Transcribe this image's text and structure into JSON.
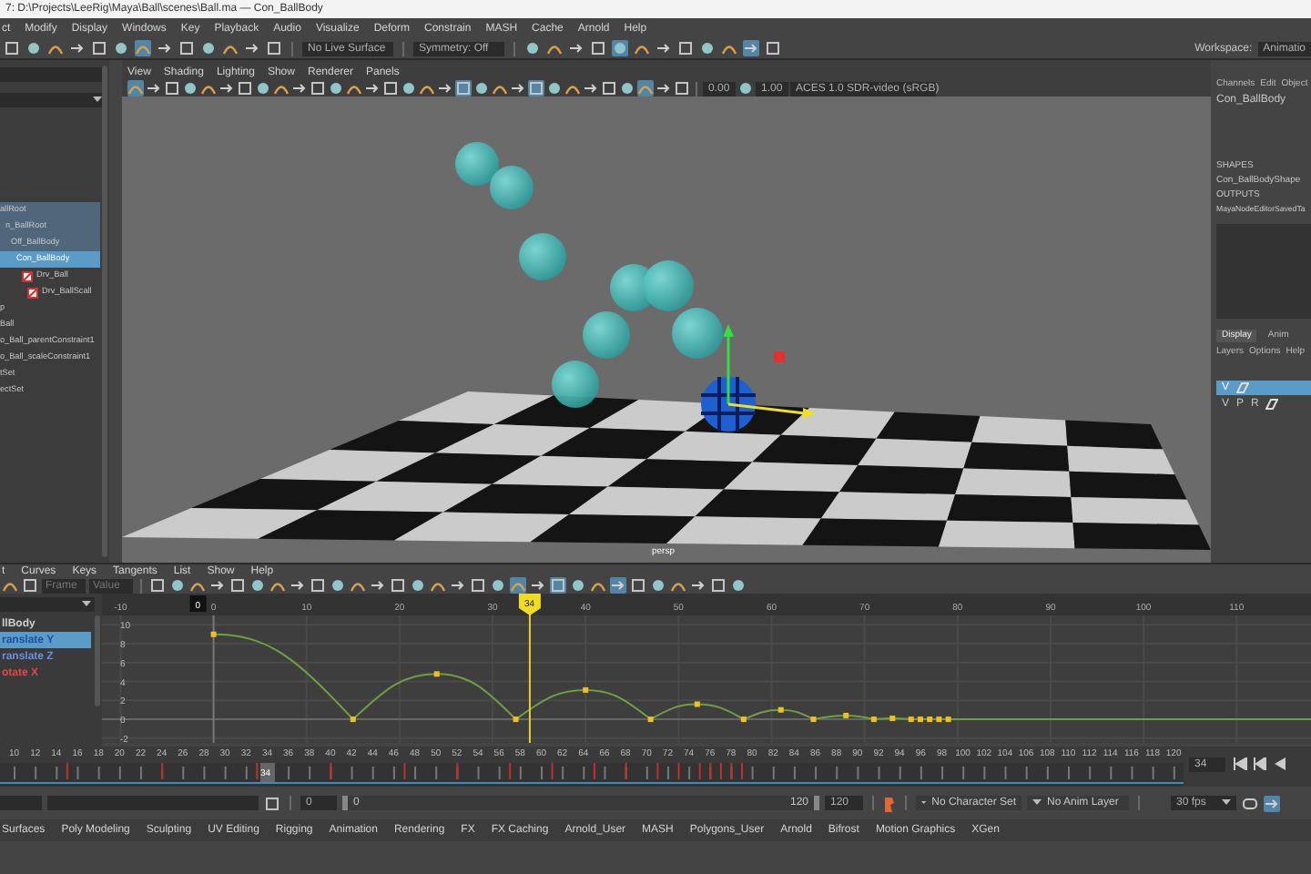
{
  "window": {
    "title": "7: D:\\Projects\\LeeRig\\Maya\\Ball\\scenes\\Ball.ma  —  Con_BallBody"
  },
  "menu_bar": [
    "ct",
    "Modify",
    "Display",
    "Windows",
    "Key",
    "Playback",
    "Audio",
    "Visualize",
    "Deform",
    "Constrain",
    "MASH",
    "Cache",
    "Arnold",
    "Help"
  ],
  "status_line": {
    "tools_left": [
      {
        "on": false
      },
      {
        "on": false
      },
      {
        "on": false
      },
      {
        "on": false
      },
      {
        "on": false
      },
      {
        "on": false
      },
      {
        "on": true
      },
      {
        "on": false
      },
      {
        "on": false
      },
      {
        "on": false
      },
      {
        "on": false
      },
      {
        "on": false
      },
      {
        "on": false
      }
    ],
    "live_surface": "No Live Surface",
    "symmetry": "Symmetry: Off",
    "tools_right": [
      {
        "on": false
      },
      {
        "on": false
      },
      {
        "on": false
      },
      {
        "on": false
      },
      {
        "on": true
      },
      {
        "on": false
      },
      {
        "on": false
      },
      {
        "on": false
      },
      {
        "on": false
      },
      {
        "on": false
      },
      {
        "on": true
      },
      {
        "on": false
      }
    ],
    "workspace_label": "Workspace:",
    "workspace": "Animatio"
  },
  "outliner": {
    "items": [
      {
        "label": "allRoot",
        "icon": false,
        "selected": false,
        "highlighted": true,
        "children": [
          {
            "label": "n_BallRoot",
            "icon": false,
            "selected": false,
            "highlighted": true,
            "children": [
              {
                "label": "Off_BallBody",
                "icon": false,
                "selected": false,
                "highlighted": true,
                "children": [
                  {
                    "label": "Con_BallBody",
                    "icon": false,
                    "selected": true,
                    "highlighted": false,
                    "children": [
                      {
                        "label": "Drv_Ball",
                        "icon": true,
                        "selected": false,
                        "highlighted": false,
                        "children": [
                          {
                            "label": "Drv_BallScall",
                            "icon": true,
                            "selected": false,
                            "highlighted": false
                          }
                        ]
                      }
                    ]
                  }
                ]
              }
            ]
          }
        ]
      },
      {
        "label": "p",
        "icon": false,
        "selected": false,
        "highlighted": false
      },
      {
        "label": "Ball",
        "icon": false,
        "selected": false,
        "highlighted": false
      },
      {
        "label": "o_Ball_parentConstraint1",
        "icon": false,
        "selected": false,
        "highlighted": false
      },
      {
        "label": "o_Ball_scaleConstraint1",
        "icon": false,
        "selected": false,
        "highlighted": false
      },
      {
        "label": "tSet",
        "icon": false,
        "selected": false,
        "highlighted": false
      },
      {
        "label": "ectSet",
        "icon": false,
        "selected": false,
        "highlighted": false
      }
    ]
  },
  "viewport": {
    "menus": [
      "View",
      "Shading",
      "Lighting",
      "Show",
      "Renderer",
      "Panels"
    ],
    "tools": [
      {
        "on": true
      },
      {
        "on": false
      },
      {
        "on": false
      },
      {
        "on": false
      },
      {
        "on": false
      },
      {
        "on": false
      },
      {
        "on": false
      },
      {
        "on": false
      },
      {
        "on": false
      },
      {
        "on": false
      },
      {
        "on": false
      },
      {
        "on": false
      },
      {
        "on": false
      },
      {
        "on": false
      },
      {
        "on": false
      },
      {
        "on": false
      },
      {
        "on": false
      },
      {
        "on": false
      },
      {
        "on": true
      },
      {
        "on": false
      },
      {
        "on": false
      },
      {
        "on": false
      },
      {
        "on": true
      },
      {
        "on": false
      },
      {
        "on": false
      },
      {
        "on": false
      },
      {
        "on": false
      },
      {
        "on": false
      },
      {
        "on": true
      },
      {
        "on": false
      },
      {
        "on": false
      }
    ],
    "exposure": "0.00",
    "gamma": "1.00",
    "color_space": "ACES 1.0 SDR-video (sRGB)",
    "camera": "persp"
  },
  "channel_box": {
    "tabs": [
      "Channels",
      "Edit",
      "Object"
    ],
    "node": "Con_BallBody",
    "shapes_heading": "SHAPES",
    "shape": "Con_BallBodyShape",
    "outputs_heading": "OUTPUTS",
    "output": "MayaNodeEditorSavedTa"
  },
  "layer_editor": {
    "tabs": [
      {
        "label": "Display",
        "selected": true
      },
      {
        "label": "Anim",
        "selected": false
      }
    ],
    "menus": [
      "Layers",
      "Options",
      "Help"
    ],
    "layers": [
      {
        "flags": [
          "V"
        ],
        "selected": true
      },
      {
        "flags": [
          "V",
          "P",
          "R"
        ],
        "selected": false
      }
    ]
  },
  "graph_editor": {
    "menus": [
      "t",
      "Curves",
      "Keys",
      "Tangents",
      "List",
      "Show",
      "Help"
    ],
    "frame_placeholder": "Frame",
    "value_placeholder": "Value",
    "tools": [
      {
        "on": false
      },
      {
        "on": false
      },
      {
        "on": false
      },
      {
        "on": false
      },
      {
        "on": false
      },
      {
        "on": false
      },
      {
        "on": false
      },
      {
        "on": false
      },
      {
        "on": false
      },
      {
        "on": false
      },
      {
        "on": false
      },
      {
        "on": false
      },
      {
        "on": false
      },
      {
        "on": false
      },
      {
        "on": false
      },
      {
        "on": false
      },
      {
        "on": false
      },
      {
        "on": false
      },
      {
        "on": true
      },
      {
        "on": false
      },
      {
        "on": true
      },
      {
        "on": false
      },
      {
        "on": false
      },
      {
        "on": true
      },
      {
        "on": false
      },
      {
        "on": false
      },
      {
        "on": false
      },
      {
        "on": false
      },
      {
        "on": false
      },
      {
        "on": false
      }
    ],
    "channels": [
      {
        "label": "llBody",
        "color": "#d0d0d0",
        "selected": false
      },
      {
        "label": "ranslate Y",
        "color": "#1f4f9f",
        "selected": true
      },
      {
        "label": "ranslate Z",
        "color": "#6b8ee0",
        "selected": false
      },
      {
        "label": "otate X",
        "color": "#e04848",
        "selected": false
      }
    ],
    "range_start": "0",
    "current_frame": "34",
    "chart_data": {
      "type": "line",
      "x": [
        0,
        15,
        24,
        32.5,
        40,
        47,
        52,
        57,
        61,
        64.5,
        68,
        71,
        73,
        75,
        76,
        77,
        78,
        79
      ],
      "grid": true,
      "ref_lines": [
        {
          "axis": "y",
          "value": 0,
          "color": "#6fa040"
        },
        {
          "axis": "x",
          "value": 34,
          "color": "#e8d030"
        }
      ],
      "series": [
        {
          "color": "#6fa040",
          "marker": "square",
          "values": [
            9,
            0,
            4.8,
            0,
            3.1,
            0,
            1.6,
            0,
            1,
            0,
            0.4,
            0,
            0.1,
            0,
            0,
            0,
            0,
            0
          ]
        }
      ],
      "xlim": [
        -12,
        118
      ],
      "ylim": [
        -2.5,
        11
      ],
      "xticks": [
        -10,
        0,
        10,
        20,
        30,
        40,
        50,
        60,
        70,
        80,
        90,
        100,
        110
      ],
      "yticks": [
        -2,
        0,
        2,
        4,
        6,
        8,
        10
      ]
    }
  },
  "time_slider": {
    "frame_labels": [
      "10",
      "12",
      "14",
      "16",
      "18",
      "20",
      "22",
      "24",
      "26",
      "28",
      "30",
      "32",
      "34",
      "36",
      "38",
      "40",
      "42",
      "44",
      "46",
      "48",
      "50",
      "52",
      "54",
      "56",
      "58",
      "60",
      "62",
      "64",
      "66",
      "68",
      "70",
      "72",
      "74",
      "76",
      "78",
      "80",
      "82",
      "84",
      "86",
      "88",
      "90",
      "92",
      "94",
      "96",
      "98",
      "100",
      "102",
      "104",
      "106",
      "108",
      "110",
      "112",
      "114",
      "116",
      "118",
      "120"
    ],
    "current_frame": "34",
    "frame_field": "34"
  },
  "range_slider": {
    "start": "0",
    "range_start": "0",
    "range_end": "120",
    "end": "120",
    "level": 1,
    "character_set": "No Character Set",
    "anim_layer": "No Anim Layer",
    "fps": "30 fps"
  },
  "shelf_tabs": [
    "Surfaces",
    "Poly Modeling",
    "Sculpting",
    "UV Editing",
    "Rigging",
    "Animation",
    "Rendering",
    "FX",
    "FX Caching",
    "Arnold_User",
    "MASH",
    "Polygons_User",
    "Arnold",
    "Bifrost",
    "Motion Graphics",
    "XGen"
  ]
}
